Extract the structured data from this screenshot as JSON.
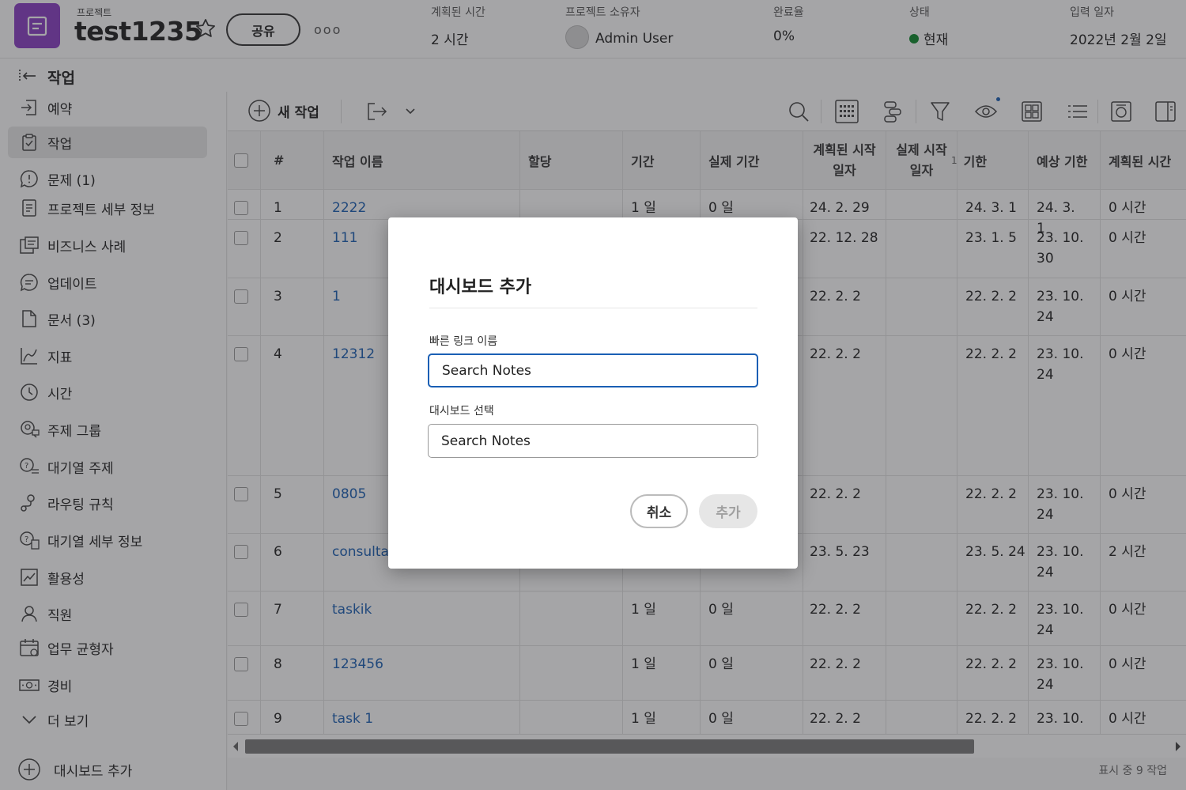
{
  "header": {
    "project_label": "프로젝트",
    "project_title": "test1235",
    "share_label": "공유",
    "more_label": "ooo",
    "meta": [
      {
        "label": "계획된 시간",
        "value": "2 시간"
      },
      {
        "label": "프로젝트 소유자",
        "value": "Admin User"
      },
      {
        "label": "완료율",
        "value": "0%"
      },
      {
        "label": "상태",
        "value": "현재"
      },
      {
        "label": "입력 일자",
        "value": "2022년 2월 2일"
      }
    ],
    "status_color": "#0e8a2d",
    "project_color": "#8b3fc4"
  },
  "subbar": {
    "title": "작업"
  },
  "sidebar": {
    "items": [
      {
        "label": "예약",
        "icon": "enter-icon"
      },
      {
        "label": "작업",
        "icon": "clipboard-check-icon"
      },
      {
        "label": "문제 (1)",
        "icon": "alert-bubble-icon"
      },
      {
        "label": "프로젝트 세부 정보",
        "icon": "document-lines-icon"
      },
      {
        "label": "비즈니스 사례",
        "icon": "case-icon"
      },
      {
        "label": "업데이트",
        "icon": "chat-bubble-icon"
      },
      {
        "label": "문서 (3)",
        "icon": "file-icon"
      },
      {
        "label": "지표",
        "icon": "line-chart-icon"
      },
      {
        "label": "시간",
        "icon": "clock-icon"
      },
      {
        "label": "주제 그룹",
        "icon": "topic-group-icon"
      },
      {
        "label": "대기열 주제",
        "icon": "queue-topic-icon"
      },
      {
        "label": "라우팅 규칙",
        "icon": "routing-icon"
      },
      {
        "label": "대기열 세부 정보",
        "icon": "queue-details-icon"
      },
      {
        "label": "활용성",
        "icon": "utilization-icon"
      },
      {
        "label": "직원",
        "icon": "person-icon"
      },
      {
        "label": "업무 균형자",
        "icon": "calendar-icon"
      },
      {
        "label": "경비",
        "icon": "money-icon"
      },
      {
        "label": "더 보기",
        "icon": "chevron-down-icon"
      }
    ],
    "add_dashboard": "대시보드 추가"
  },
  "toolbar": {
    "new_task": "새 작업"
  },
  "table": {
    "columns": [
      "#",
      "작업 이름",
      "할당",
      "기간",
      "실제 기간",
      "계획된 시작 일자",
      "실제 시작 일자",
      "기한",
      "예상 기한",
      "계획된 시간"
    ],
    "sort_indicator": "1",
    "rows": [
      {
        "num": "1",
        "name": "2222",
        "assign": "",
        "duration": "1 일",
        "actual": "0 일",
        "pstart": "24. 2. 29",
        "astart": "",
        "due": "24. 3. 1",
        "proj": "24. 3. 1",
        "hours": "0 시간"
      },
      {
        "num": "2",
        "name": "111",
        "assign": "",
        "duration": "",
        "actual": "",
        "pstart": "22. 12. 28",
        "astart": "",
        "due": "23. 1. 5",
        "proj": "23. 10. 30",
        "hours": "0 시간"
      },
      {
        "num": "3",
        "name": "1",
        "assign": "",
        "duration": "",
        "actual": "",
        "pstart": "22. 2. 2",
        "astart": "",
        "due": "22. 2. 2",
        "proj": "23. 10. 24",
        "hours": "0 시간"
      },
      {
        "num": "4",
        "name": "12312",
        "assign": "",
        "duration": "",
        "actual": "",
        "pstart": "22. 2. 2",
        "astart": "",
        "due": "22. 2. 2",
        "proj": "23. 10. 24",
        "hours": "0 시간"
      },
      {
        "num": "5",
        "name": "0805",
        "assign": "",
        "duration": "",
        "actual": "",
        "pstart": "22. 2. 2",
        "astart": "",
        "due": "22. 2. 2",
        "proj": "23. 10. 24",
        "hours": "0 시간"
      },
      {
        "num": "6",
        "name": "consulta",
        "assign": "t",
        "duration": "",
        "actual": "",
        "pstart": "23. 5. 23",
        "astart": "",
        "due": "23. 5. 24",
        "proj": "23. 10. 24",
        "hours": "2 시간"
      },
      {
        "num": "7",
        "name": "taskik",
        "assign": "",
        "duration": "1 일",
        "actual": "0 일",
        "pstart": "22. 2. 2",
        "astart": "",
        "due": "22. 2. 2",
        "proj": "23. 10. 24",
        "hours": "0 시간"
      },
      {
        "num": "8",
        "name": "123456",
        "assign": "",
        "duration": "1 일",
        "actual": "0 일",
        "pstart": "22. 2. 2",
        "astart": "",
        "due": "22. 2. 2",
        "proj": "23. 10. 24",
        "hours": "0 시간"
      },
      {
        "num": "9",
        "name": "task 1",
        "assign": "",
        "duration": "1 일",
        "actual": "0 일",
        "pstart": "22. 2. 2",
        "astart": "",
        "due": "22. 2. 2",
        "proj": "23. 10.",
        "hours": "0 시간"
      }
    ]
  },
  "footer": {
    "count_text": "표시 중 9 작업"
  },
  "modal": {
    "title": "대시보드 추가",
    "field1_label": "빠른 링크 이름",
    "field1_value": "Search Notes",
    "field2_label": "대시보드 선택",
    "field2_value": "Search Notes",
    "cancel_label": "취소",
    "add_label": "추가"
  }
}
